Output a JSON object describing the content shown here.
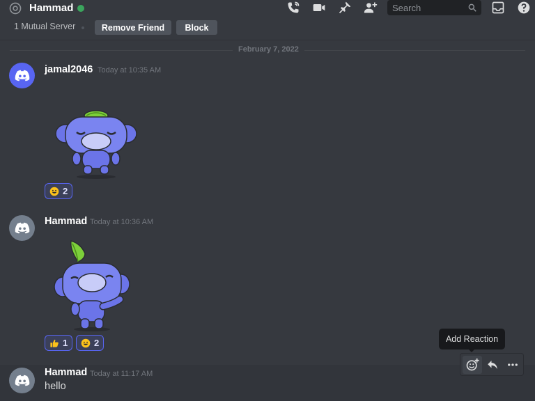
{
  "header": {
    "title": "Hammad",
    "search_placeholder": "Search",
    "icons": [
      "at-icon",
      "phone-call-icon",
      "video-camera-icon",
      "pin-icon",
      "add-friend-icon",
      "search-icon",
      "inbox-icon",
      "help-icon"
    ],
    "status_color": "#3ba55d"
  },
  "profile_bar": {
    "mutual_servers": "1 Mutual Server",
    "remove_friend_label": "Remove Friend",
    "block_label": "Block"
  },
  "date_divider": "February 7, 2022",
  "messages": [
    {
      "username": "jamal2046",
      "timestamp": "Today at 10:35 AM",
      "avatar_color": "#5865f2",
      "sticker": "wumpus-leaf-sticker",
      "reactions": [
        {
          "emoji": "grinning-face-emoji",
          "count": "2"
        }
      ]
    },
    {
      "username": "Hammad",
      "timestamp": "Today at 10:36 AM",
      "avatar_color": "#747f8d",
      "sticker": "wumpus-wave-sticker",
      "reactions": [
        {
          "emoji": "thumbs-up-emoji",
          "count": "1"
        },
        {
          "emoji": "grinning-face-emoji",
          "count": "2"
        }
      ]
    },
    {
      "username": "Hammad",
      "timestamp": "Today at 11:17 AM",
      "avatar_color": "#747f8d",
      "text": "hello"
    }
  ],
  "tooltip": "Add Reaction",
  "toolbar": [
    "add-reaction-icon",
    "reply-icon",
    "more-icon"
  ],
  "colors": {
    "background": "#36393f",
    "accent": "#5865f2",
    "tooltip_bg": "#18191c"
  }
}
